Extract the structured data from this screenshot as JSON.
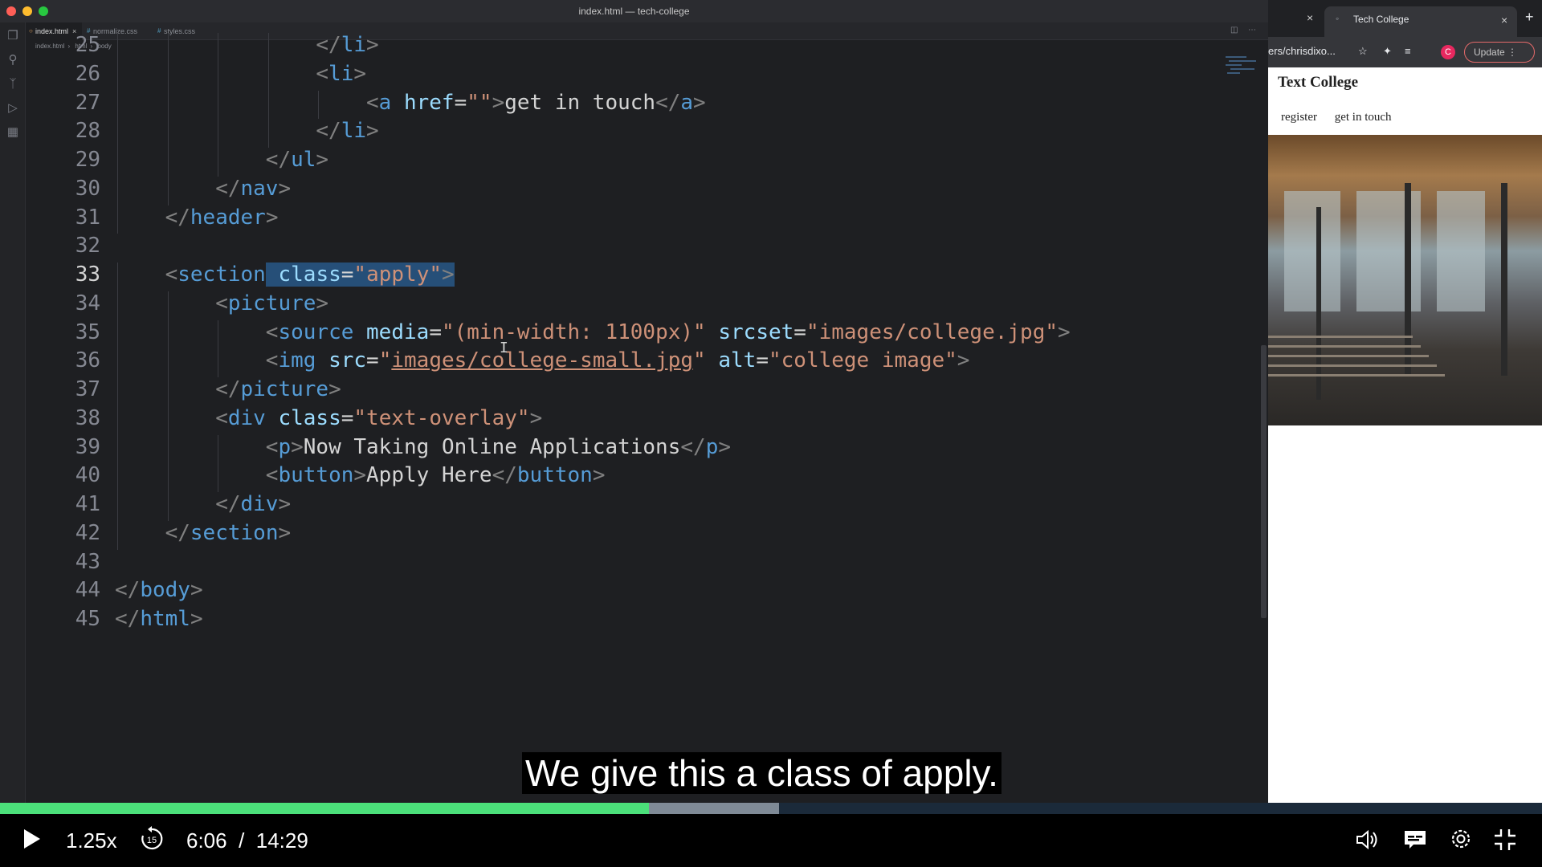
{
  "window": {
    "title": "index.html — tech-college"
  },
  "editor": {
    "tabs": [
      {
        "label": "index.html",
        "active": true
      },
      {
        "label": "normalize.css",
        "active": false
      },
      {
        "label": "styles.css",
        "active": false
      }
    ],
    "breadcrumb": [
      "index.html",
      "html",
      "body"
    ],
    "activity_icons": [
      "files-icon",
      "search-icon",
      "source-control-icon",
      "run-debug-icon",
      "extensions-icon"
    ],
    "lines": [
      {
        "n": "25",
        "indent": 4,
        "tokens": [
          [
            "p",
            "</"
          ],
          [
            "t",
            "li"
          ],
          [
            "p",
            ">"
          ]
        ]
      },
      {
        "n": "26",
        "indent": 4,
        "tokens": [
          [
            "p",
            "<"
          ],
          [
            "t",
            "li"
          ],
          [
            "p",
            ">"
          ]
        ]
      },
      {
        "n": "27",
        "indent": 5,
        "tokens": [
          [
            "p",
            "<"
          ],
          [
            "t",
            "a"
          ],
          [
            "tx",
            " "
          ],
          [
            "a",
            "href"
          ],
          [
            "tx",
            "="
          ],
          [
            "s",
            "\"\""
          ],
          [
            "p",
            ">"
          ],
          [
            "tx",
            "get in touch"
          ],
          [
            "p",
            "</"
          ],
          [
            "t",
            "a"
          ],
          [
            "p",
            ">"
          ]
        ]
      },
      {
        "n": "28",
        "indent": 4,
        "tokens": [
          [
            "p",
            "</"
          ],
          [
            "t",
            "li"
          ],
          [
            "p",
            ">"
          ]
        ]
      },
      {
        "n": "29",
        "indent": 3,
        "tokens": [
          [
            "p",
            "</"
          ],
          [
            "t",
            "ul"
          ],
          [
            "p",
            ">"
          ]
        ]
      },
      {
        "n": "30",
        "indent": 2,
        "tokens": [
          [
            "p",
            "</"
          ],
          [
            "t",
            "nav"
          ],
          [
            "p",
            ">"
          ]
        ]
      },
      {
        "n": "31",
        "indent": 1,
        "tokens": [
          [
            "p",
            "</"
          ],
          [
            "t",
            "header"
          ],
          [
            "p",
            ">"
          ]
        ]
      },
      {
        "n": "32",
        "indent": 0,
        "tokens": []
      },
      {
        "n": "33",
        "indent": 1,
        "current": true,
        "tokens": [
          [
            "p",
            "<"
          ],
          [
            "t",
            "section"
          ],
          [
            "sel",
            " "
          ],
          [
            "sel-a",
            "class"
          ],
          [
            "sel-tx",
            "="
          ],
          [
            "sel-s",
            "\"apply\""
          ],
          [
            "sel-p",
            ">"
          ]
        ]
      },
      {
        "n": "34",
        "indent": 2,
        "tokens": [
          [
            "p",
            "<"
          ],
          [
            "t",
            "picture"
          ],
          [
            "p",
            ">"
          ]
        ]
      },
      {
        "n": "35",
        "indent": 3,
        "tokens": [
          [
            "p",
            "<"
          ],
          [
            "t",
            "source"
          ],
          [
            "tx",
            " "
          ],
          [
            "a",
            "media"
          ],
          [
            "tx",
            "="
          ],
          [
            "s",
            "\"(min-width: 1100px)\""
          ],
          [
            "tx",
            " "
          ],
          [
            "a",
            "srcset"
          ],
          [
            "tx",
            "="
          ],
          [
            "s",
            "\"images/college.jpg\""
          ],
          [
            "p",
            ">"
          ]
        ]
      },
      {
        "n": "36",
        "indent": 3,
        "tokens": [
          [
            "p",
            "<"
          ],
          [
            "t",
            "img"
          ],
          [
            "tx",
            " "
          ],
          [
            "a",
            "src"
          ],
          [
            "tx",
            "="
          ],
          [
            "s",
            "\""
          ],
          [
            "ul",
            "images/college-small.jpg"
          ],
          [
            "s",
            "\""
          ],
          [
            "tx",
            " "
          ],
          [
            "a",
            "alt"
          ],
          [
            "tx",
            "="
          ],
          [
            "s",
            "\"college image\""
          ],
          [
            "p",
            ">"
          ]
        ]
      },
      {
        "n": "37",
        "indent": 2,
        "tokens": [
          [
            "p",
            "</"
          ],
          [
            "t",
            "picture"
          ],
          [
            "p",
            ">"
          ]
        ]
      },
      {
        "n": "38",
        "indent": 2,
        "tokens": [
          [
            "p",
            "<"
          ],
          [
            "t",
            "div"
          ],
          [
            "tx",
            " "
          ],
          [
            "a",
            "class"
          ],
          [
            "tx",
            "="
          ],
          [
            "s",
            "\"text-overlay\""
          ],
          [
            "p",
            ">"
          ]
        ]
      },
      {
        "n": "39",
        "indent": 3,
        "tokens": [
          [
            "p",
            "<"
          ],
          [
            "t",
            "p"
          ],
          [
            "p",
            ">"
          ],
          [
            "tx",
            "Now Taking Online Applications"
          ],
          [
            "p",
            "</"
          ],
          [
            "t",
            "p"
          ],
          [
            "p",
            ">"
          ]
        ]
      },
      {
        "n": "40",
        "indent": 3,
        "tokens": [
          [
            "p",
            "<"
          ],
          [
            "t",
            "button"
          ],
          [
            "p",
            ">"
          ],
          [
            "tx",
            "Apply Here"
          ],
          [
            "p",
            "</"
          ],
          [
            "t",
            "button"
          ],
          [
            "p",
            ">"
          ]
        ]
      },
      {
        "n": "41",
        "indent": 2,
        "tokens": [
          [
            "p",
            "</"
          ],
          [
            "t",
            "div"
          ],
          [
            "p",
            ">"
          ]
        ]
      },
      {
        "n": "42",
        "indent": 1,
        "tokens": [
          [
            "p",
            "</"
          ],
          [
            "t",
            "section"
          ],
          [
            "p",
            ">"
          ]
        ]
      },
      {
        "n": "43",
        "indent": 0,
        "tokens": []
      },
      {
        "n": "44",
        "indent": 0,
        "tokens": [
          [
            "p",
            "</"
          ],
          [
            "t",
            "body"
          ],
          [
            "p",
            ">"
          ]
        ]
      },
      {
        "n": "45",
        "indent": 0,
        "tokens": [
          [
            "p",
            "</"
          ],
          [
            "t",
            "html"
          ],
          [
            "p",
            ">"
          ]
        ]
      }
    ]
  },
  "browser": {
    "tab_title": "Tech College",
    "url": "ers/chrisdixo...",
    "avatar_letter": "C",
    "update_label": "Update",
    "site": {
      "title": "Text College",
      "nav": [
        "register",
        "get in touch"
      ]
    }
  },
  "player": {
    "subtitle": "We give this a class of apply.",
    "speed": "1.25x",
    "current_time": "6:06",
    "separator": "/",
    "duration": "14:29",
    "rewind_seconds": "15",
    "progress_fraction": 0.421,
    "buffer_fraction": 0.505,
    "colors": {
      "progress": "#4be07a",
      "buffer": "#7f8a96",
      "track": "#1b2a3a"
    }
  },
  "theme": {
    "punct": "#808080",
    "tag": "#569cd6",
    "attr": "#9cdcfe",
    "string": "#ce9178",
    "text": "#d4d4d4",
    "selection": "#264f78"
  }
}
